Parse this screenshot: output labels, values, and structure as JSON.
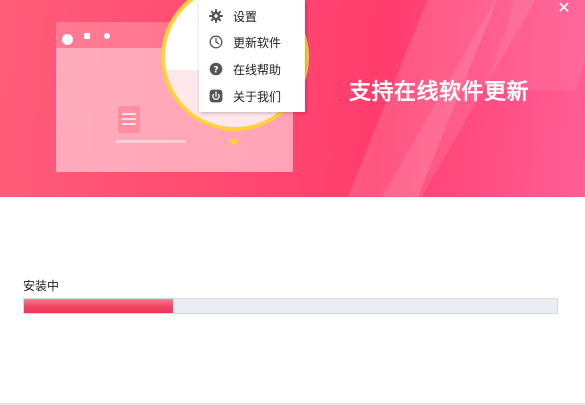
{
  "window": {
    "close_glyph": "✕"
  },
  "banner": {
    "slogan": "支持在线软件更新",
    "gradient": [
      "#ff5d7a",
      "#ff3d6e",
      "#ff5e97"
    ],
    "bubble_ring_color": "#ffd13a"
  },
  "menu": {
    "items": [
      {
        "icon": "gear-icon",
        "label": "设置"
      },
      {
        "icon": "clock-icon",
        "label": "更新软件"
      },
      {
        "icon": "help-icon",
        "label": "在线帮助"
      },
      {
        "icon": "about-icon",
        "label": "关于我们"
      }
    ]
  },
  "install": {
    "status": "安装中",
    "progress": 0.28,
    "accent": "#ee405e"
  }
}
